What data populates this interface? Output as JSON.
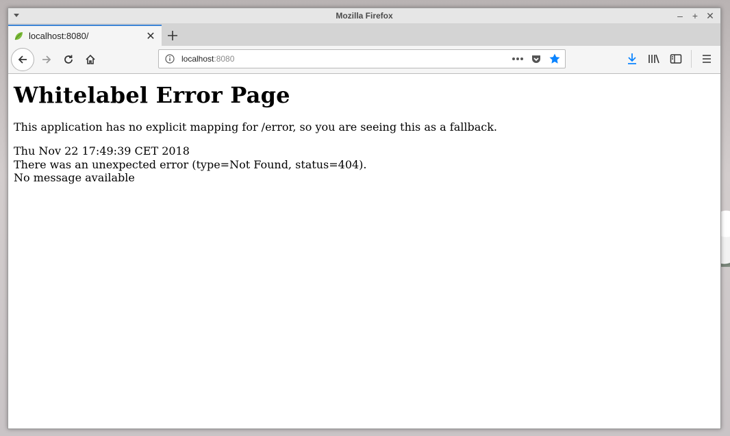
{
  "window": {
    "title": "Mozilla Firefox"
  },
  "tab": {
    "title": "localhost:8080/"
  },
  "urlbar": {
    "host": "localhost",
    "port": ":8080"
  },
  "icons": {
    "favicon": "spring-leaf-icon",
    "back": "back-arrow-icon",
    "forward": "forward-arrow-icon",
    "reload": "reload-icon",
    "home": "home-icon",
    "info": "info-icon",
    "more": "more-dots-icon",
    "pocket": "pocket-icon",
    "bookmark": "star-icon",
    "download": "download-icon",
    "library": "library-icon",
    "sidebar": "sidebar-icon",
    "menu": "hamburger-menu-icon"
  },
  "colors": {
    "accent": "#3b84d6",
    "star": "#0a84ff",
    "download": "#0a84ff"
  },
  "page": {
    "heading": "Whitelabel Error Page",
    "explanation": "This application has no explicit mapping for /error, so you are seeing this as a fallback.",
    "timestamp": "Thu Nov 22 17:49:39 CET 2018",
    "error": "There was an unexpected error (type=Not Found, status=404).",
    "message": "No message available"
  }
}
